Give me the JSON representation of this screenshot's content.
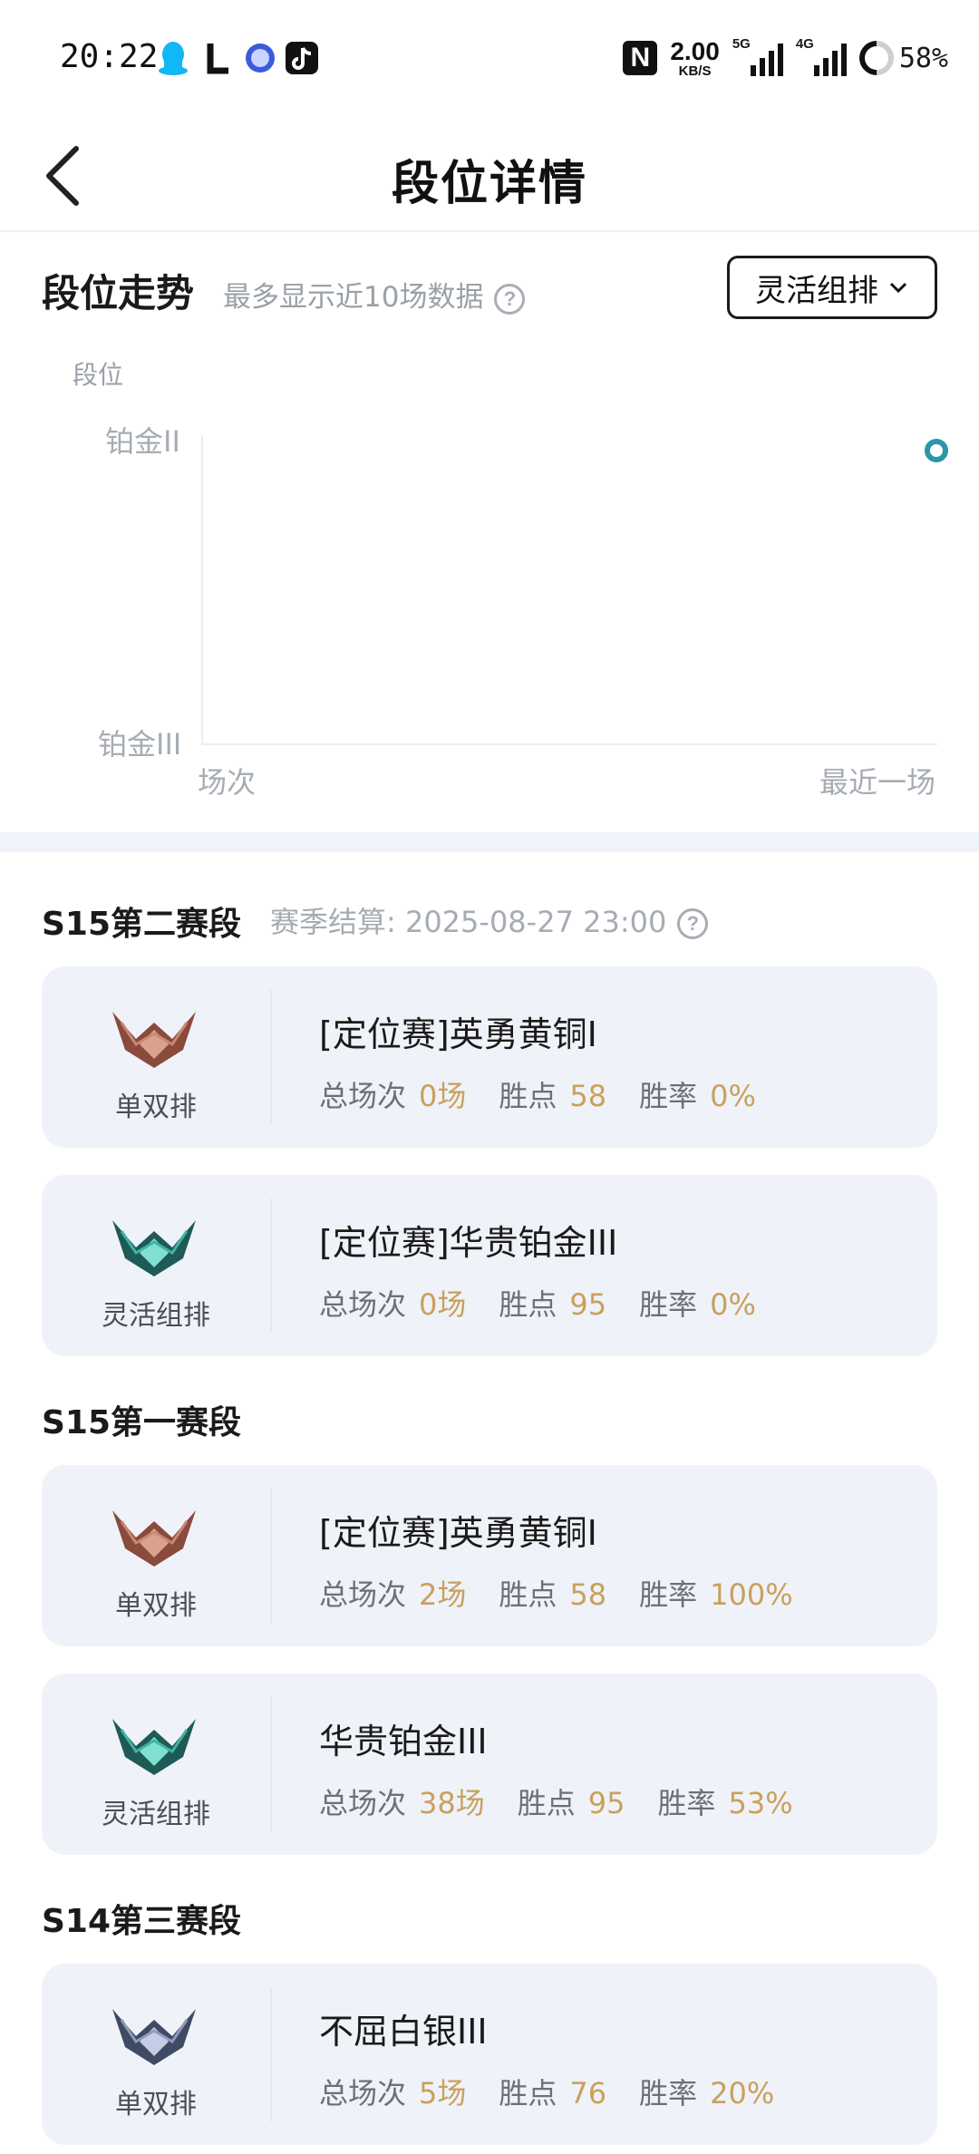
{
  "status_bar": {
    "time": "20:22",
    "net_speed_value": "2.00",
    "net_speed_unit": "KB/S",
    "sim1_label": "5G",
    "sim2_label": "4G",
    "battery": "58%"
  },
  "nav": {
    "title": "段位详情"
  },
  "trend": {
    "title": "段位走势",
    "subtitle": "最多显示近10场数据",
    "mode_selected": "灵活组排"
  },
  "chart_data": {
    "type": "line",
    "y_title": "段位",
    "y_ticks": [
      "铂金II",
      "铂金III"
    ],
    "x_ticks": [
      "场次",
      "最近一场"
    ],
    "points": [
      {
        "x": "最近一场",
        "y": "铂金II"
      }
    ],
    "series_color": "#2a97a8"
  },
  "seasons": [
    {
      "name": "S15第二赛段",
      "settle": "赛季结算: 2025-08-27 23:00",
      "records": [
        {
          "queue": "单双排",
          "rank": "[定位赛]英勇黄铜I",
          "total_label": "总场次",
          "total": "0场",
          "points_label": "胜点",
          "points": "58",
          "winrate_label": "胜率",
          "winrate": "0%",
          "tier": "bronze"
        },
        {
          "queue": "灵活组排",
          "rank": "[定位赛]华贵铂金III",
          "total_label": "总场次",
          "total": "0场",
          "points_label": "胜点",
          "points": "95",
          "winrate_label": "胜率",
          "winrate": "0%",
          "tier": "platinum"
        }
      ]
    },
    {
      "name": "S15第一赛段",
      "settle": "",
      "records": [
        {
          "queue": "单双排",
          "rank": "[定位赛]英勇黄铜I",
          "total_label": "总场次",
          "total": "2场",
          "points_label": "胜点",
          "points": "58",
          "winrate_label": "胜率",
          "winrate": "100%",
          "tier": "bronze"
        },
        {
          "queue": "灵活组排",
          "rank": "华贵铂金III",
          "total_label": "总场次",
          "total": "38场",
          "points_label": "胜点",
          "points": "95",
          "winrate_label": "胜率",
          "winrate": "53%",
          "tier": "platinum"
        }
      ]
    },
    {
      "name": "S14第三赛段",
      "settle": "",
      "records": [
        {
          "queue": "单双排",
          "rank": "不屈白银III",
          "total_label": "总场次",
          "total": "5场",
          "points_label": "胜点",
          "points": "76",
          "winrate_label": "胜率",
          "winrate": "20%",
          "tier": "silver"
        }
      ]
    }
  ],
  "colors": {
    "accent_value": "#c9a15b",
    "chart_point": "#2a97a8",
    "card_bg": "#eff2f8"
  }
}
